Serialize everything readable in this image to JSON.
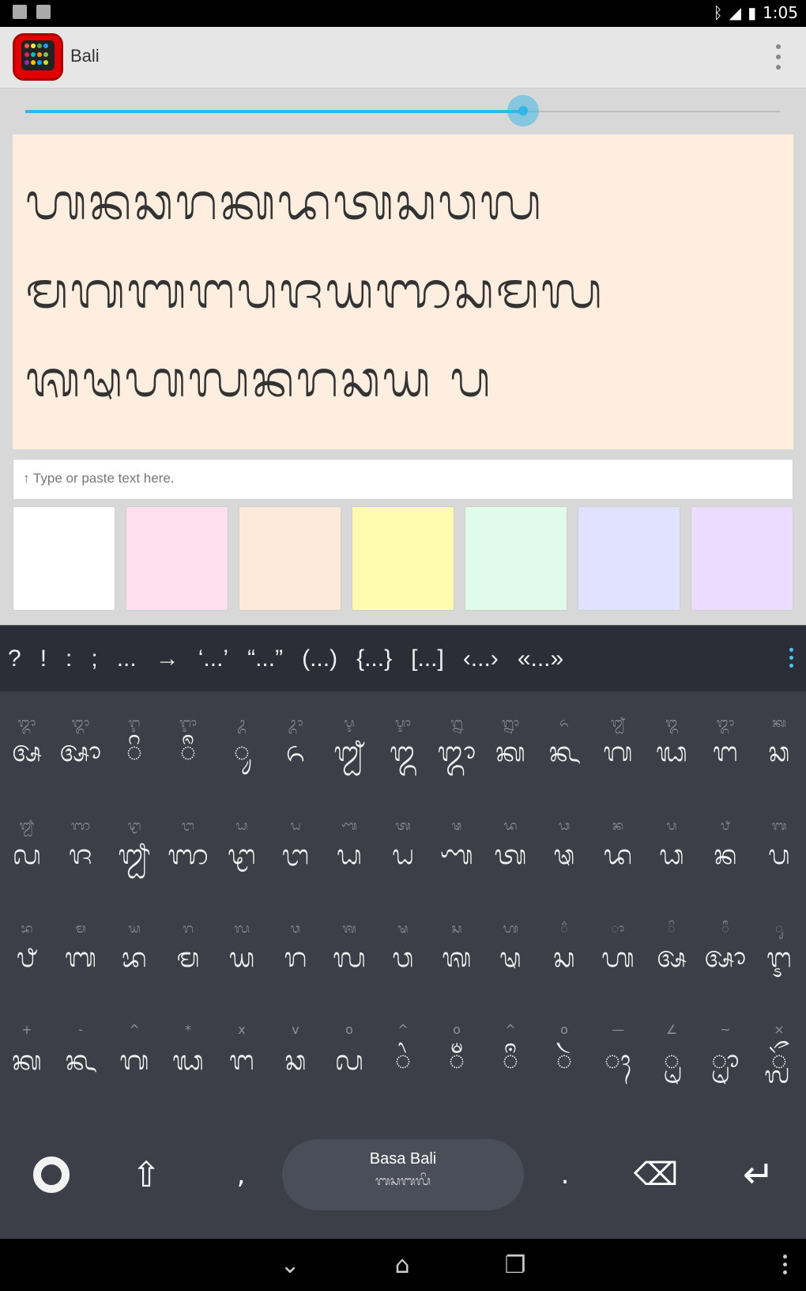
{
  "status_bar": {
    "time": "1:05"
  },
  "action_bar": {
    "title": "Bali"
  },
  "slider": {
    "value": 0.66
  },
  "preview": {
    "lines": [
      "ᬳᬦᬘᬭᬓᬤᬢᬲᬯᬮ",
      "ᬫᬕᬩᬗᬧᬚᬬᬜᬲᬫᬮ",
      "ᬰᬱᬳᬮᬦᬭᬘᬬ ᬧ"
    ]
  },
  "input": {
    "placeholder": "↑ Type or paste text here."
  },
  "swatches": [
    "#ffffff",
    "#ffe0ee",
    "#fde9d8",
    "#fffbae",
    "#e0fbea",
    "#e0e2ff",
    "#ecdcff"
  ],
  "punct_row": [
    "?",
    "!",
    ":",
    ";",
    "...",
    "→",
    "‘...’",
    "“...”",
    "(...)",
    "{...}",
    "[...]",
    "‹...›",
    "«...»"
  ],
  "key_rows": [
    [
      {
        "hint": "ᬒ",
        "main": "ᬅ"
      },
      {
        "hint": "ᬒ",
        "main": "ᬆ"
      },
      {
        "hint": "ᬇ",
        "main": "ᬶ"
      },
      {
        "hint": "ᬈ",
        "main": "ᬷ"
      },
      {
        "hint": "ᬉ",
        "main": "ᬸ"
      },
      {
        "hint": "ᬊ",
        "main": "ᬏ"
      },
      {
        "hint": "ᬋ",
        "main": "ᬐ"
      },
      {
        "hint": "ᬌ",
        "main": "ᬑ"
      },
      {
        "hint": "ᬍ",
        "main": "ᬒ"
      },
      {
        "hint": "ᬎ",
        "main": "ᬓ"
      },
      {
        "hint": "ᬏ",
        "main": "ᬔ"
      },
      {
        "hint": "ᬐ",
        "main": "ᬕ"
      },
      {
        "hint": "ᬑ",
        "main": "ᬖ"
      },
      {
        "hint": "ᬒ",
        "main": "ᬗ"
      },
      {
        "hint": "ᬓ",
        "main": "ᬘ"
      }
    ],
    [
      {
        "hint": "ᬛ",
        "main": "ᬙ"
      },
      {
        "hint": "ᬜ",
        "main": "ᬚ"
      },
      {
        "hint": "ᬝ",
        "main": "ᬛ"
      },
      {
        "hint": "ᬞ",
        "main": "ᬜ"
      },
      {
        "hint": "ᬟ",
        "main": "ᬝ"
      },
      {
        "hint": "ᬠ",
        "main": "ᬞ"
      },
      {
        "hint": "ᬡ",
        "main": "ᬟ"
      },
      {
        "hint": "ᬢ",
        "main": "ᬠ"
      },
      {
        "hint": "ᬣ",
        "main": "ᬡ"
      },
      {
        "hint": "ᬤ",
        "main": "ᬢ"
      },
      {
        "hint": "ᬥ",
        "main": "ᬣ"
      },
      {
        "hint": "ᬦ",
        "main": "ᬤ"
      },
      {
        "hint": "ᬧ",
        "main": "ᬥ"
      },
      {
        "hint": "ᬨ",
        "main": "ᬦ"
      },
      {
        "hint": "ᬩ",
        "main": "ᬧ"
      }
    ],
    [
      {
        "hint": "ᬪ",
        "main": "ᬨ"
      },
      {
        "hint": "ᬫ",
        "main": "ᬩ"
      },
      {
        "hint": "ᬬ",
        "main": "ᬪ"
      },
      {
        "hint": "ᬭ",
        "main": "ᬫ"
      },
      {
        "hint": "ᬮ",
        "main": "ᬬ"
      },
      {
        "hint": "ᬯ",
        "main": "ᬭ"
      },
      {
        "hint": "ᬰ",
        "main": "ᬮ"
      },
      {
        "hint": "ᬱ",
        "main": "ᬯ"
      },
      {
        "hint": "ᬲ",
        "main": "ᬰ"
      },
      {
        "hint": "ᬳ",
        "main": "ᬱ"
      },
      {
        "hint": "᬴",
        "main": "ᬲ"
      },
      {
        "hint": "ᬵ",
        "main": "ᬳ"
      },
      {
        "hint": "ᬶ",
        "main": "ᬅ"
      },
      {
        "hint": "ᬷ",
        "main": "ᬆ"
      },
      {
        "hint": "ᬸ",
        "main": "ᬇ"
      }
    ],
    [
      {
        "hint": "+",
        "main": "ᬓ"
      },
      {
        "hint": "-",
        "main": "ᬔ"
      },
      {
        "hint": "^",
        "main": "ᬕ"
      },
      {
        "hint": "*",
        "main": "ᬖ"
      },
      {
        "hint": "x",
        "main": "ᬗ"
      },
      {
        "hint": "v",
        "main": "ᬘ"
      },
      {
        "hint": "o",
        "main": "ᬙ"
      },
      {
        "hint": "^",
        "main": "ᬂ"
      },
      {
        "hint": "o",
        "main": "ᬁ"
      },
      {
        "hint": "^",
        "main": "ᬀ"
      },
      {
        "hint": "o",
        "main": "ᬃ"
      },
      {
        "hint": "—",
        "main": "ᬄ"
      },
      {
        "hint": "∠",
        "main": "ᬺ"
      },
      {
        "hint": "~",
        "main": "ᬻ"
      },
      {
        "hint": "×",
        "main": "ᬼ"
      }
    ]
  ],
  "function_row": {
    "space_line1": "Basa Bali",
    "space_line2": "ᬩᬲᬩᬮᬶ",
    "comma": ",",
    "period": "."
  }
}
